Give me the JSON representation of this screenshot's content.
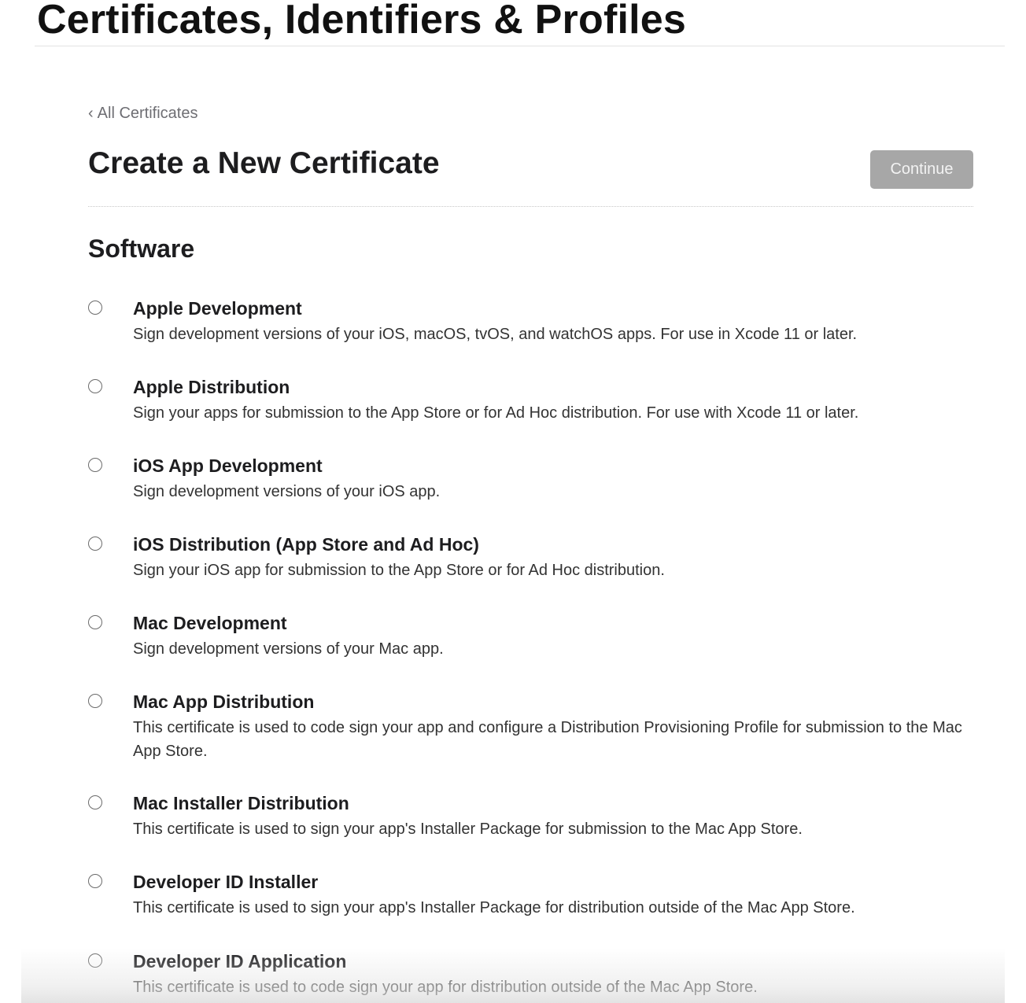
{
  "header": {
    "site_title": "Certificates, Identifiers & Profiles"
  },
  "nav": {
    "back_chevron": "‹",
    "back_label": "All Certificates"
  },
  "page": {
    "heading": "Create a New Certificate",
    "continue_label": "Continue",
    "continue_enabled": false
  },
  "section": {
    "title": "Software"
  },
  "options": [
    {
      "title": "Apple Development",
      "description": "Sign development versions of your iOS, macOS, tvOS, and watchOS apps. For use in Xcode 11 or later.",
      "selected": false
    },
    {
      "title": "Apple Distribution",
      "description": "Sign your apps for submission to the App Store or for Ad Hoc distribution. For use with Xcode 11 or later.",
      "selected": false
    },
    {
      "title": "iOS App Development",
      "description": "Sign development versions of your iOS app.",
      "selected": false
    },
    {
      "title": "iOS Distribution (App Store and Ad Hoc)",
      "description": "Sign your iOS app for submission to the App Store or for Ad Hoc distribution.",
      "selected": false
    },
    {
      "title": "Mac Development",
      "description": "Sign development versions of your Mac app.",
      "selected": false
    },
    {
      "title": "Mac App Distribution",
      "description": "This certificate is used to code sign your app and configure a Distribution Provisioning Profile for submission to the Mac App Store.",
      "selected": false
    },
    {
      "title": "Mac Installer Distribution",
      "description": "This certificate is used to sign your app's Installer Package for submission to the Mac App Store.",
      "selected": false
    },
    {
      "title": "Developer ID Installer",
      "description": "This certificate is used to sign your app's Installer Package for distribution outside of the Mac App Store.",
      "selected": false
    },
    {
      "title": "Developer ID Application",
      "description": "This certificate is used to code sign your app for distribution outside of the Mac App Store.",
      "selected": false
    }
  ]
}
